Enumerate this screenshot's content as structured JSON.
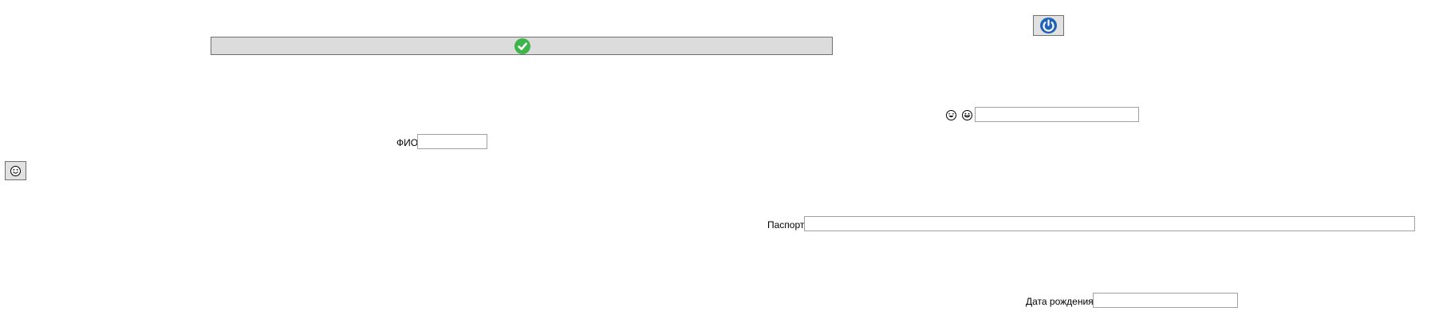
{
  "icons": {
    "status": "check-circle-icon",
    "top_action": "power-icon",
    "left_action": "smiley-icon",
    "emoji_left": "laughing-face-icon",
    "emoji_right": "grinning-face-icon"
  },
  "form": {
    "fio": {
      "label": "ФИО",
      "value": ""
    },
    "emoji_field": {
      "value": ""
    },
    "passport": {
      "label": "Паспорт",
      "value": ""
    },
    "birthdate": {
      "label": "Дата рождения",
      "value": ""
    }
  },
  "colors": {
    "check_green": "#3db54a",
    "power_blue": "#1f62b8",
    "bar_gray": "#dcdcdc"
  }
}
